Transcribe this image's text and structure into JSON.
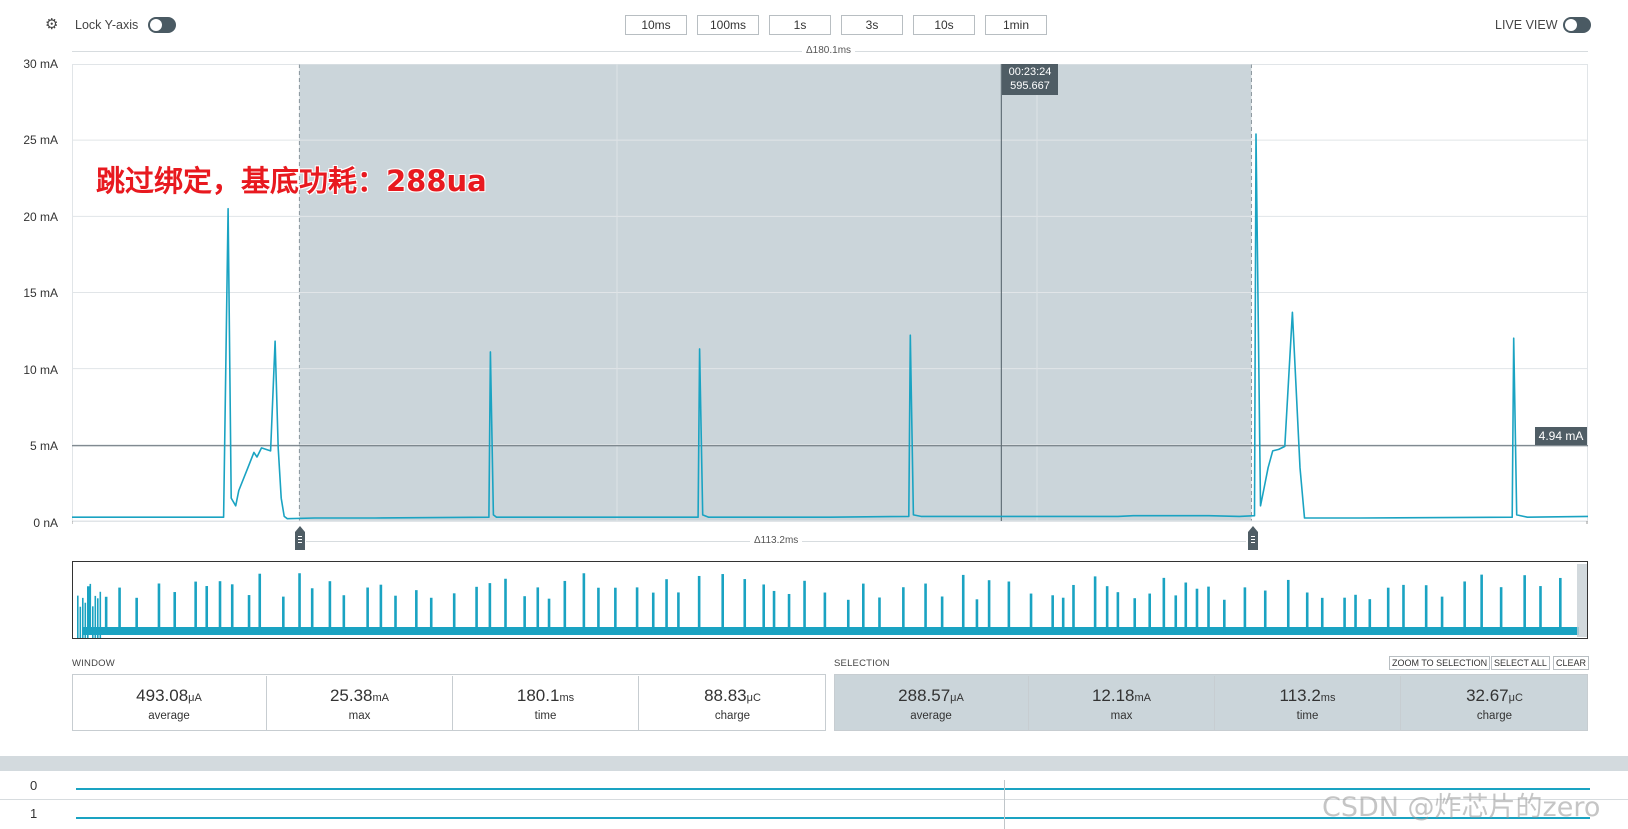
{
  "toolbar": {
    "lock_label": "Lock Y-axis",
    "zoom_buttons": [
      "10ms",
      "100ms",
      "1s",
      "3s",
      "10s",
      "1min"
    ],
    "live_view_label": "LIVE VIEW"
  },
  "chart": {
    "window_delta": "Δ180.1ms",
    "selection_delta": "Δ113.2ms",
    "cursor_time": "00:23:24",
    "cursor_value": "595.667",
    "level_marker": "4.94 mA",
    "annotation": "跳过绑定，基底功耗：288ua",
    "colors": {
      "trace": "#1aa3c2",
      "selection": "#cbd5da",
      "marker": "#4f5d65",
      "annotation": "#e8191f"
    }
  },
  "chart_data": {
    "type": "line",
    "ylabel": "",
    "y_ticks": [
      "30 mA",
      "25 mA",
      "20 mA",
      "15 mA",
      "10 mA",
      "5 mA",
      "0 nA"
    ],
    "ylim": [
      0,
      30
    ],
    "units": "mA",
    "grid": true,
    "series": [
      {
        "x": [
          0,
          10,
          10.3,
          10.5,
          10.8,
          11,
          11.6,
          12,
          12.2,
          12.5,
          13.1,
          13.4,
          13.6,
          13.8,
          14,
          14.2,
          16,
          20,
          27.5,
          27.6,
          27.8,
          28,
          30,
          41.3,
          41.4,
          41.6,
          42,
          50,
          55.2,
          55.3,
          55.5,
          56,
          60,
          69,
          70,
          75,
          77,
          78,
          78.1,
          78.4,
          78.6,
          78.9,
          79.2,
          79.6,
          80,
          80.5,
          81,
          81.3,
          81.6,
          82,
          85,
          95,
          95.1,
          95.3,
          96,
          100
        ],
        "y": [
          0.25,
          0.25,
          20.5,
          1.5,
          1,
          2,
          3.5,
          4.5,
          4.2,
          4.8,
          4.6,
          11.8,
          4.8,
          1.5,
          0.3,
          0.15,
          0.2,
          0.2,
          0.25,
          11.1,
          0.4,
          0.25,
          0.25,
          0.25,
          11.3,
          0.4,
          0.25,
          0.25,
          0.3,
          12.2,
          0.4,
          0.3,
          0.3,
          0.3,
          0.35,
          0.35,
          0.3,
          0.35,
          25.4,
          1,
          2,
          3.5,
          4.6,
          4.7,
          4.9,
          13.7,
          3.5,
          0.2,
          0.2,
          0.2,
          0.2,
          0.25,
          12,
          0.4,
          0.25,
          0.3
        ]
      }
    ],
    "selection_range": [
      15.0,
      77.8
    ],
    "cursor_x": 61.3
  },
  "window_stats": {
    "label": "WINDOW",
    "items": [
      {
        "value": "493.08",
        "unit": "μA",
        "caption": "average"
      },
      {
        "value": "25.38",
        "unit": "mA",
        "caption": "max"
      },
      {
        "value": "180.1",
        "unit": "ms",
        "caption": "time"
      },
      {
        "value": "88.83",
        "unit": "μC",
        "caption": "charge"
      }
    ]
  },
  "selection_stats": {
    "label": "SELECTION",
    "buttons": [
      "ZOOM TO SELECTION",
      "SELECT ALL",
      "CLEAR"
    ],
    "items": [
      {
        "value": "288.57",
        "unit": "μA",
        "caption": "average"
      },
      {
        "value": "12.18",
        "unit": "mA",
        "caption": "max"
      },
      {
        "value": "113.2",
        "unit": "ms",
        "caption": "time"
      },
      {
        "value": "32.67",
        "unit": "μC",
        "caption": "charge"
      }
    ]
  },
  "digital_channels": [
    "0",
    "1"
  ],
  "watermark": "CSDN @炸芯片的zero"
}
